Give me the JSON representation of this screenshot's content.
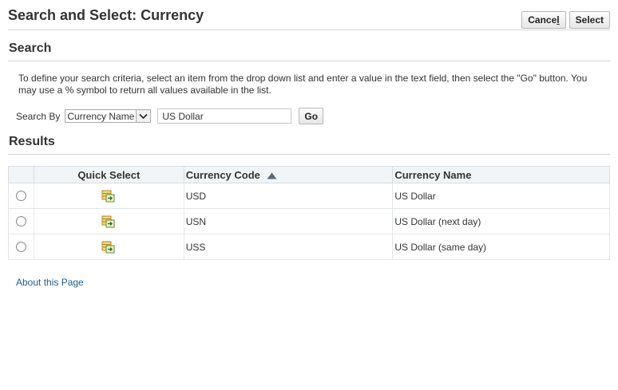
{
  "page": {
    "title": "Search and Select: Currency"
  },
  "buttons": {
    "cancel_prefix": "Cance",
    "cancel_accel": "l",
    "select": "Select",
    "go": "Go"
  },
  "search": {
    "heading": "Search",
    "instructions": "To define your search criteria, select an item from the drop down list and enter a value in the text field, then select the \"Go\" button. You may use a % symbol to return all values available in the list.",
    "search_by_label": "Search By",
    "search_by_value": "Currency Name",
    "text_value": "US Dollar"
  },
  "results": {
    "heading": "Results",
    "columns": {
      "quick_select": "Quick Select",
      "code": "Currency Code",
      "name": "Currency Name"
    },
    "rows": [
      {
        "code": "USD",
        "name": "US Dollar"
      },
      {
        "code": "USN",
        "name": "US Dollar (next day)"
      },
      {
        "code": "USS",
        "name": "US Dollar (same day)"
      }
    ]
  },
  "footer": {
    "about_link": "About this Page"
  },
  "icons": {
    "quick_select": "quick-select-icon",
    "sort": "sort-ascending-icon",
    "dropdown": "chevron-down-icon"
  },
  "colors": {
    "link": "#1f5a96",
    "header_bg": "#f2f5f7"
  }
}
